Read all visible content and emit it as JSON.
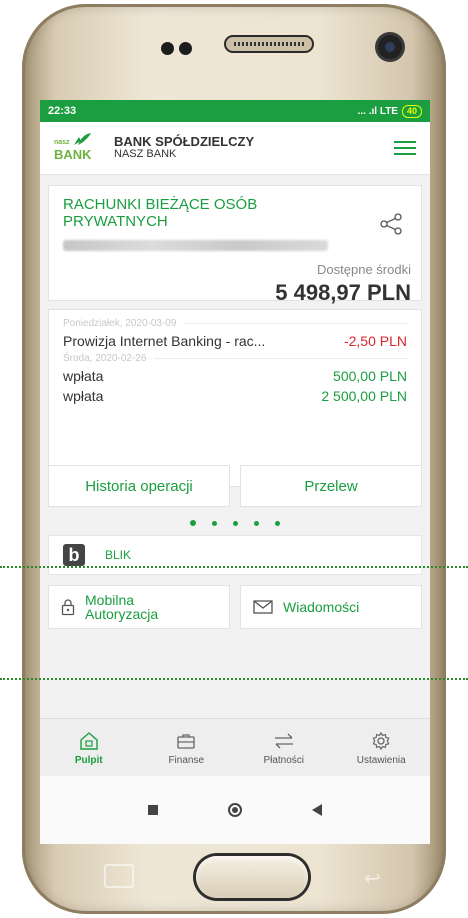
{
  "status": {
    "time": "22:33",
    "signal": "... .ıl LTE",
    "battery": "40"
  },
  "header": {
    "logo_small": "nasz",
    "logo_big": "BANK",
    "title": "BANK SPÓŁDZIELCZY",
    "subtitle": "NASZ BANK"
  },
  "account": {
    "title": "RACHUNKI BIEŻĄCE OSÓB PRYWATNYCH",
    "available_label": "Dostępne środki",
    "balance": "5 498,97 PLN"
  },
  "operations": [
    {
      "date": "Poniedziałek, 2020-03-09",
      "items": [
        {
          "label": "Prowizja Internet Banking - rac...",
          "amount": "-2,50 PLN"
        }
      ]
    },
    {
      "date": "Środa, 2020-02-26",
      "items": [
        {
          "label": "wpłata",
          "amount": "500,00 PLN"
        },
        {
          "label": "wpłata",
          "amount": "2 500,00 PLN"
        }
      ]
    }
  ],
  "actions": {
    "history": "Historia operacji",
    "transfer": "Przelew"
  },
  "carousel": {
    "count": 5,
    "active": 0
  },
  "blik": {
    "label": "BLIK"
  },
  "tiles": {
    "mobile_auth_line1": "Mobilna",
    "mobile_auth_line2": "Autoryzacja",
    "messages": "Wiadomości"
  },
  "nav": {
    "items": [
      "Pulpit",
      "Finanse",
      "Płatności",
      "Ustawienia"
    ],
    "active": 0
  },
  "colors": {
    "brand_green": "#1a9e3f",
    "negative": "#d9262c",
    "status_bar": "#1a9e3f"
  }
}
